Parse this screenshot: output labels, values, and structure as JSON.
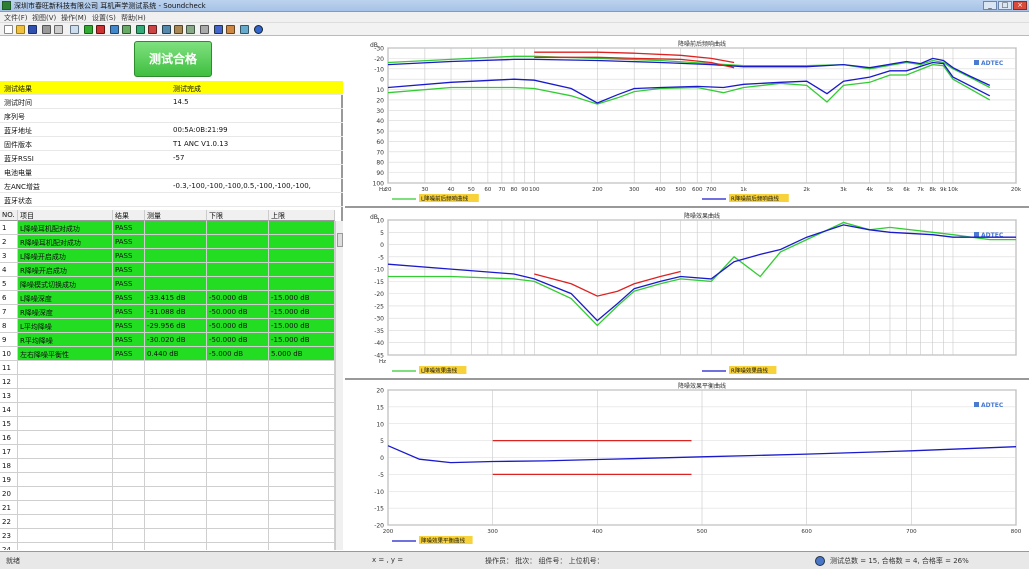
{
  "window": {
    "title": "深圳市春旺新科技有限公司 耳机声学测试系统 - Soundcheck"
  },
  "menu": [
    "文件(F)",
    "视图(V)",
    "操作(M)",
    "设置(S)",
    "帮助(H)"
  ],
  "result": {
    "label": "测试合格",
    "color": "#3fbf3f"
  },
  "info": [
    {
      "key": "测试结果",
      "value": "测试完成",
      "highlight": true
    },
    {
      "key": "测试时间",
      "value": "14.5"
    },
    {
      "key": "序列号",
      "value": ""
    },
    {
      "key": "蓝牙地址",
      "value": "00:5A:0B:21:99"
    },
    {
      "key": "固件版本",
      "value": "T1 ANC V1.0.13"
    },
    {
      "key": "蓝牙RSSI",
      "value": "-57"
    },
    {
      "key": "电池电量",
      "value": ""
    },
    {
      "key": "左ANC增益",
      "value": "-0.3,-100,-100,-100,0.5,-100,-100,-100,"
    },
    {
      "key": "蓝牙状态",
      "value": ""
    }
  ],
  "grid": {
    "headers": [
      "NO.",
      "项目",
      "结果",
      "测量",
      "下限",
      "上限"
    ],
    "rows": [
      {
        "no": "1",
        "item": "L降噪耳机配对成功",
        "result": "PASS",
        "value": "",
        "low": "",
        "high": "",
        "pass": true
      },
      {
        "no": "2",
        "item": "R降噪耳机配对成功",
        "result": "PASS",
        "value": "",
        "low": "",
        "high": "",
        "pass": true
      },
      {
        "no": "3",
        "item": "L降噪开启成功",
        "result": "PASS",
        "value": "",
        "low": "",
        "high": "",
        "pass": true
      },
      {
        "no": "4",
        "item": "R降噪开启成功",
        "result": "PASS",
        "value": "",
        "low": "",
        "high": "",
        "pass": true
      },
      {
        "no": "5",
        "item": "降噪模式切换成功",
        "result": "PASS",
        "value": "",
        "low": "",
        "high": "",
        "pass": true
      },
      {
        "no": "6",
        "item": "L降噪深度",
        "result": "PASS",
        "value": "-33.415 dB",
        "low": "-50.000 dB",
        "high": "-15.000 dB",
        "pass": true
      },
      {
        "no": "7",
        "item": "R降噪深度",
        "result": "PASS",
        "value": "-31.088 dB",
        "low": "-50.000 dB",
        "high": "-15.000 dB",
        "pass": true
      },
      {
        "no": "8",
        "item": "L平均降噪",
        "result": "PASS",
        "value": "-29.956 dB",
        "low": "-50.000 dB",
        "high": "-15.000 dB",
        "pass": true
      },
      {
        "no": "9",
        "item": "R平均降噪",
        "result": "PASS",
        "value": "-30.020 dB",
        "low": "-50.000 dB",
        "high": "-15.000 dB",
        "pass": true
      },
      {
        "no": "10",
        "item": "左右降噪平衡性",
        "result": "PASS",
        "value": "0.440 dB",
        "low": "-5.000 dB",
        "high": "5.000 dB",
        "pass": true
      },
      {
        "no": "11"
      },
      {
        "no": "12"
      },
      {
        "no": "13"
      },
      {
        "no": "14"
      },
      {
        "no": "15"
      },
      {
        "no": "16"
      },
      {
        "no": "17"
      },
      {
        "no": "18"
      },
      {
        "no": "19"
      },
      {
        "no": "20"
      },
      {
        "no": "21"
      },
      {
        "no": "22"
      },
      {
        "no": "23"
      },
      {
        "no": "24"
      }
    ]
  },
  "chart_data": [
    {
      "type": "line",
      "title": "降噪前后频响曲线",
      "ylabel": "dB",
      "brand": "ADTEC",
      "ylim": [
        -30,
        100
      ],
      "yticks": [
        -30,
        -20,
        -10,
        0,
        10,
        20,
        30,
        40,
        50,
        60,
        70,
        80,
        90,
        100
      ],
      "yticklabels": [
        "100",
        "90",
        "80",
        "70",
        "60",
        "50",
        "40",
        "30",
        "20",
        "10",
        "0",
        "-10",
        "-20",
        "-30"
      ],
      "xscale": "log",
      "xlim": [
        20,
        20000
      ],
      "xticks": [
        20,
        30,
        40,
        50,
        60,
        70,
        80,
        90,
        100,
        200,
        300,
        400,
        500,
        600,
        700,
        1000,
        2000,
        3000,
        4000,
        5000,
        6000,
        7000,
        8000,
        9000,
        10000,
        20000
      ],
      "xticklabels": [
        "20",
        "30",
        "40",
        "50",
        "60",
        "70",
        "80",
        "90",
        "100",
        "200",
        "300",
        "400",
        "500",
        "600",
        "700",
        "1k",
        "2k",
        "3k",
        "4k",
        "5k",
        "6k",
        "7k",
        "8k",
        "9k",
        "10k",
        "20k"
      ],
      "xlabel": "Hz",
      "legend": [
        "L降噪前后频响曲线",
        "R降噪前后频响曲线"
      ],
      "series": [
        {
          "name": "L降噪前后频响曲线",
          "color": "#33cc33",
          "x": [
            20,
            40,
            80,
            100,
            200,
            400,
            700,
            1000,
            2000,
            3000,
            4000,
            6000,
            7000,
            8000,
            9000,
            10000,
            12000,
            15000
          ],
          "y": [
            86,
            89,
            92,
            92,
            90,
            88,
            85,
            83,
            83,
            84,
            80,
            86,
            84,
            88,
            86,
            80,
            72,
            62
          ]
        },
        {
          "name": "",
          "color": "#1a1acc",
          "x": [
            20,
            40,
            80,
            100,
            200,
            400,
            700,
            1000,
            2000,
            3000,
            4000,
            6000,
            7000,
            8000,
            9000,
            10000,
            12000,
            15000
          ],
          "y": [
            84,
            87,
            89,
            89,
            88,
            86,
            84,
            82,
            82,
            84,
            81,
            87,
            85,
            90,
            88,
            81,
            73,
            64
          ]
        },
        {
          "name": "",
          "color": "#dd2222",
          "x": [
            100,
            200,
            300,
            500,
            700,
            900
          ],
          "y": [
            96,
            96,
            95,
            93,
            90,
            86
          ]
        },
        {
          "name": "",
          "color": "#dd2222",
          "x": [
            100,
            200,
            300,
            500,
            700,
            900
          ],
          "y": [
            91,
            91,
            90,
            89,
            86,
            81
          ]
        },
        {
          "name": "",
          "color": "#33cc33",
          "x": [
            20,
            40,
            80,
            100,
            150,
            200,
            250,
            300,
            400,
            600,
            800,
            1000,
            1500,
            2000,
            2500,
            3000,
            4000,
            5000,
            6000,
            8000,
            9000,
            10000,
            15000
          ],
          "y": [
            57,
            62,
            62,
            61,
            54,
            46,
            52,
            58,
            61,
            62,
            57,
            62,
            66,
            64,
            48,
            64,
            67,
            74,
            74,
            84,
            83,
            70,
            50
          ]
        },
        {
          "name": "R降噪前后频响曲线",
          "color": "#1a1acc",
          "x": [
            20,
            40,
            80,
            100,
            150,
            200,
            250,
            300,
            400,
            600,
            800,
            1000,
            1500,
            2000,
            2500,
            3000,
            4000,
            5000,
            6000,
            8000,
            9000,
            10000,
            15000
          ],
          "y": [
            62,
            67,
            70,
            69,
            61,
            47,
            55,
            61,
            62,
            63,
            62,
            65,
            67,
            68,
            56,
            68,
            72,
            78,
            78,
            86,
            85,
            72,
            54
          ]
        }
      ]
    },
    {
      "type": "line",
      "title": "降噪效果曲线",
      "ylabel": "dB",
      "brand": "ADTEC",
      "ylim": [
        -45,
        10
      ],
      "yticks": [
        10,
        5,
        0,
        -5,
        -10,
        -15,
        -20,
        -25,
        -30,
        -35,
        -40,
        -45
      ],
      "xscale": "log",
      "xlim": [
        20,
        20000
      ],
      "xlabel": "Hz",
      "legend": [
        "L降噪效果曲线",
        "R降噪效果曲线"
      ],
      "series": [
        {
          "name": "",
          "color": "#dd2222",
          "x": [
            100,
            150,
            200,
            250,
            300,
            400,
            500
          ],
          "y": [
            -12,
            -16,
            -21,
            -19,
            -16,
            -13,
            -11
          ]
        },
        {
          "name": "L降噪效果曲线",
          "color": "#33cc33",
          "x": [
            20,
            40,
            80,
            100,
            150,
            200,
            250,
            300,
            400,
            500,
            700,
            900,
            1200,
            1500,
            2000,
            3000,
            4000,
            5000,
            8000,
            10000,
            15000,
            20000
          ],
          "y": [
            -13,
            -13,
            -14,
            -15,
            -22,
            -33,
            -25,
            -19,
            -16,
            -14,
            -15,
            -5,
            -13,
            -3,
            2,
            9,
            6,
            7,
            5,
            4,
            2,
            2
          ]
        },
        {
          "name": "R降噪效果曲线",
          "color": "#1a1acc",
          "x": [
            20,
            40,
            80,
            100,
            150,
            200,
            250,
            300,
            400,
            500,
            700,
            900,
            1200,
            1500,
            2000,
            3000,
            4000,
            5000,
            8000,
            10000,
            15000,
            20000
          ],
          "y": [
            -8,
            -10,
            -12,
            -14,
            -20,
            -31,
            -24,
            -18,
            -15,
            -13,
            -14,
            -7,
            -4,
            -2,
            3,
            8,
            6,
            5,
            4,
            3,
            3,
            3
          ]
        }
      ]
    },
    {
      "type": "line",
      "title": "降噪效果平衡曲线",
      "brand": "ADTEC",
      "ylim": [
        -20,
        20
      ],
      "yticks": [
        20,
        15,
        10,
        5,
        0,
        -5,
        -10,
        -15,
        -20
      ],
      "xlim": [
        200,
        800
      ],
      "xticks": [
        200,
        300,
        400,
        500,
        600,
        700,
        800
      ],
      "xticklabels": [
        "200",
        "300",
        "400",
        "500",
        "600",
        "700",
        "800"
      ],
      "legend": [
        "降噪效果平衡曲线"
      ],
      "series": [
        {
          "name": "",
          "color": "#dd2222",
          "x": [
            300,
            490
          ],
          "y": [
            5,
            5
          ]
        },
        {
          "name": "",
          "color": "#dd2222",
          "x": [
            300,
            490
          ],
          "y": [
            -5,
            -5
          ]
        },
        {
          "name": "降噪效果平衡曲线",
          "color": "#1a1acc",
          "x": [
            200,
            230,
            260,
            300,
            350,
            400,
            450,
            500,
            550,
            600,
            700,
            800
          ],
          "y": [
            3.5,
            -0.5,
            -1.5,
            -1.2,
            -1.0,
            -0.6,
            -0.2,
            0.2,
            0.6,
            1.0,
            2.0,
            3.2
          ]
        }
      ]
    }
  ],
  "status": {
    "left": "就绪",
    "coords": "x = , y = ",
    "operator": "操作员：    批次：    组件号：    上位机号：",
    "summary": "测试总数 = 15, 合格数 = 4, 合格率 = 26%"
  },
  "colors": {
    "pass": "#22dd22",
    "highlight": "#ffff00"
  }
}
